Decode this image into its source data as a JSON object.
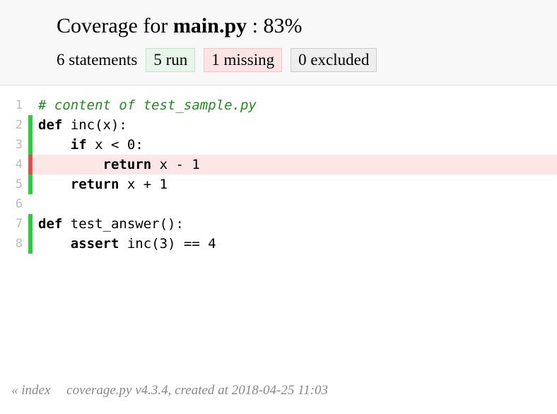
{
  "header": {
    "title_prefix": "Coverage for ",
    "filename": "main.py",
    "title_sep": " : ",
    "percent": "83%",
    "statements_count": "6",
    "statements_label": " statements",
    "run_count": "5",
    "run_label": " run",
    "missing_count": "1",
    "missing_label": " missing",
    "excluded_count": "0",
    "excluded_label": " excluded"
  },
  "lines": [
    {
      "n": "1",
      "status": "none",
      "kind": "comment",
      "text": "# content of test_sample.py"
    },
    {
      "n": "2",
      "status": "run",
      "kind": "def",
      "tokens": [
        "def ",
        "inc",
        "(x):"
      ]
    },
    {
      "n": "3",
      "status": "run",
      "kind": "stmt",
      "tokens": [
        "    ",
        "if ",
        "x < ",
        "0",
        ":"
      ]
    },
    {
      "n": "4",
      "status": "miss",
      "kind": "stmt",
      "tokens": [
        "        ",
        "return ",
        "x - ",
        "1"
      ]
    },
    {
      "n": "5",
      "status": "run",
      "kind": "stmt",
      "tokens": [
        "    ",
        "return ",
        "x + ",
        "1"
      ]
    },
    {
      "n": "6",
      "status": "none",
      "kind": "blank",
      "text": ""
    },
    {
      "n": "7",
      "status": "run",
      "kind": "def",
      "tokens": [
        "def ",
        "test_answer",
        "():"
      ]
    },
    {
      "n": "8",
      "status": "run",
      "kind": "stmt",
      "tokens": [
        "    ",
        "assert ",
        "inc(",
        "3",
        ") == ",
        "4"
      ]
    }
  ],
  "footer": {
    "index_link": "« index",
    "info": "coverage.py v4.3.4, created at 2018-04-25 11:03"
  }
}
